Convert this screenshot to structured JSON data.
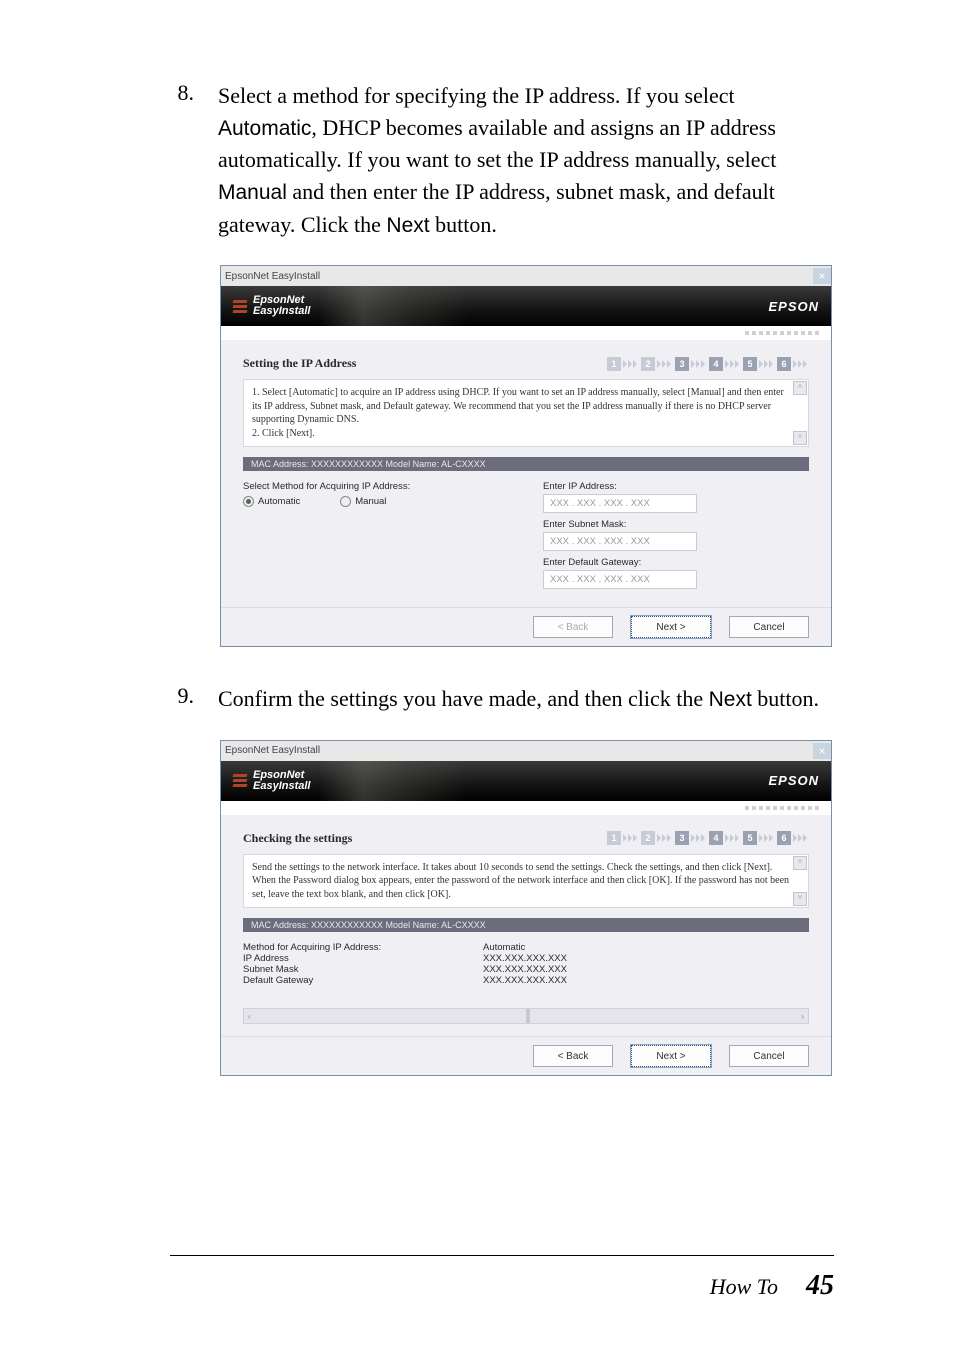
{
  "steps": [
    {
      "num": "8.",
      "paragraph": "Select a method for specifying the IP address. If you select {sans:Automatic}, DHCP becomes available and assigns an IP address automatically. If you want to set the IP address manually, select {sans:Manual} and then enter the IP address, subnet mask, and default gateway. Click the {sans:Next} button."
    },
    {
      "num": "9.",
      "paragraph": "Confirm the settings you have made, and then click the {sans:Next} button."
    }
  ],
  "dialog1": {
    "titlebar": "EpsonNet EasyInstall",
    "banner_l1": "EpsonNet",
    "banner_l2": "EasyInstall",
    "brand": "EPSON",
    "section_title": "Setting the IP Address",
    "step_strip": [
      "1",
      "2",
      "3",
      "4",
      "5",
      "6"
    ],
    "step_strip_dim": [
      0,
      1
    ],
    "instructions": "1. Select [Automatic] to acquire an IP address using DHCP. If you want to set an IP address manually, select [Manual] and then enter its IP address, Subnet mask, and Default gateway. We recommend that you set the IP address manually if there is no DHCP server supporting Dynamic DNS.\n2. Click [Next].",
    "darkbar": "MAC Address: XXXXXXXXXXXX    Model Name: AL-CXXXX",
    "left_label": "Select Method for Acquiring IP Address:",
    "radio_auto": "Automatic",
    "radio_manual": "Manual",
    "fields": [
      {
        "label": "Enter IP Address:",
        "value": "XXX . XXX . XXX . XXX"
      },
      {
        "label": "Enter Subnet Mask:",
        "value": "XXX . XXX . XXX . XXX"
      },
      {
        "label": "Enter Default Gateway:",
        "value": "XXX . XXX . XXX . XXX"
      }
    ],
    "btn_back": "< Back",
    "btn_next": "Next >",
    "btn_cancel": "Cancel"
  },
  "dialog2": {
    "titlebar": "EpsonNet EasyInstall",
    "banner_l1": "EpsonNet",
    "banner_l2": "EasyInstall",
    "brand": "EPSON",
    "section_title": "Checking the settings",
    "step_strip": [
      "1",
      "2",
      "3",
      "4",
      "5",
      "6"
    ],
    "step_strip_dim": [
      0,
      1
    ],
    "instructions": "Send the settings to the network interface. It takes about 10 seconds to send the settings. Check the settings, and then click [Next].\nWhen the Password dialog box appears, enter the password of the network interface and then click [OK]. If the password has not been set, leave the text box blank, and then click [OK].",
    "darkbar": "MAC Address: XXXXXXXXXXXX    Model Name: AL-CXXXX",
    "summary": [
      {
        "k": "Method for Acquiring IP Address:",
        "v": "Automatic"
      },
      {
        "k": "IP Address",
        "v": "XXX.XXX.XXX.XXX"
      },
      {
        "k": "Subnet Mask",
        "v": "XXX.XXX.XXX.XXX"
      },
      {
        "k": "Default Gateway",
        "v": "XXX.XXX.XXX.XXX"
      }
    ],
    "btn_back": "< Back",
    "btn_next": "Next >",
    "btn_cancel": "Cancel"
  },
  "footer": {
    "howto": "How To",
    "page": "45"
  }
}
